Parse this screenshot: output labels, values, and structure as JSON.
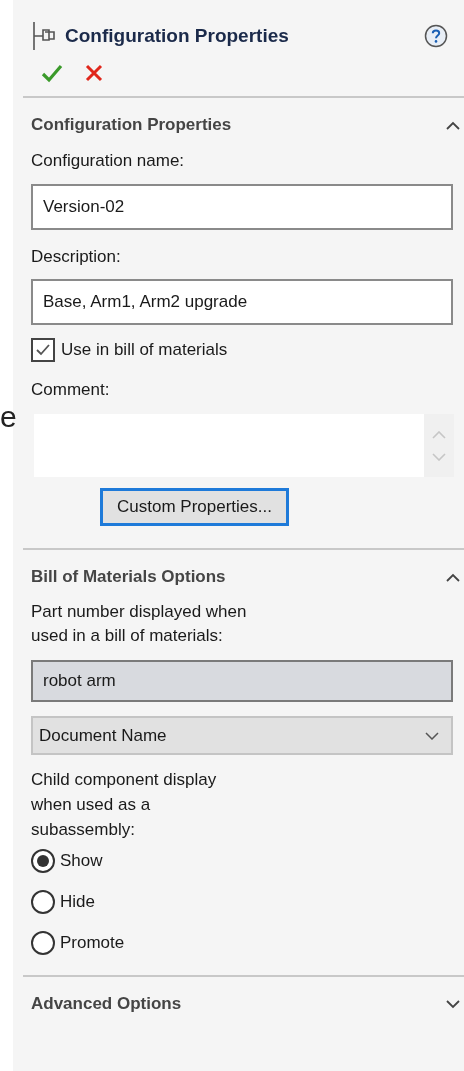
{
  "background_text": "e",
  "panel": {
    "title": "Configuration Properties"
  },
  "config_section": {
    "heading": "Configuration Properties",
    "expanded": true,
    "name_label": "Configuration name:",
    "name_value": "Version-02",
    "description_label": "Description:",
    "description_value": "Base, Arm1, Arm2 upgrade",
    "use_in_bom": {
      "label": "Use in bill of materials",
      "checked": true
    },
    "comment_label": "Comment:",
    "custom_button": "Custom Properties..."
  },
  "bom_section": {
    "heading": "Bill of Materials Options",
    "expanded": true,
    "part_number_label": "Part number displayed when used in a bill of materials:",
    "part_number_value": "robot arm",
    "source_dropdown": "Document Name",
    "child_label": "Child component display when used as a subassembly:",
    "child_options": [
      {
        "label": "Show",
        "selected": true
      },
      {
        "label": "Hide",
        "selected": false
      },
      {
        "label": "Promote",
        "selected": false
      }
    ]
  },
  "advanced_section": {
    "heading": "Advanced Options",
    "expanded": false
  }
}
